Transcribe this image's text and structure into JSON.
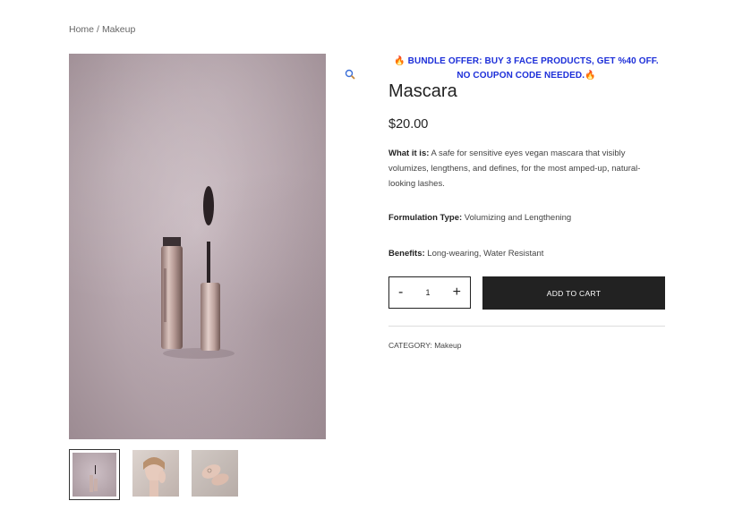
{
  "breadcrumb": {
    "home": "Home",
    "separator": "/",
    "current": "Makeup"
  },
  "offer": {
    "text": "BUNDLE OFFER: BUY 3 FACE PRODUCTS, GET %40 OFF. NO COUPON CODE NEEDED.",
    "icon": "fire-icon",
    "color": "#1d2fd9"
  },
  "product": {
    "title": "Mascara",
    "price": "$20.00",
    "what_it_is_label": "What it is:",
    "what_it_is": " A safe for sensitive eyes vegan mascara that visibly volumizes, lengthens, and defines, for the most amped-up, natural-looking lashes.",
    "formulation_label": "Formulation Type:",
    "formulation": " Volumizing and Lengthening",
    "benefits_label": "Benefits:",
    "benefits": " Long-wearing, Water Resistant"
  },
  "quantity": {
    "minus": "-",
    "value": "1",
    "plus": "+"
  },
  "cart": {
    "add_label": "ADD TO CART"
  },
  "meta": {
    "category_label": "CATEGORY:",
    "category": "Makeup"
  },
  "gallery": {
    "thumbnails": [
      "mascara",
      "woman-face",
      "hands"
    ],
    "active_index": 0
  }
}
